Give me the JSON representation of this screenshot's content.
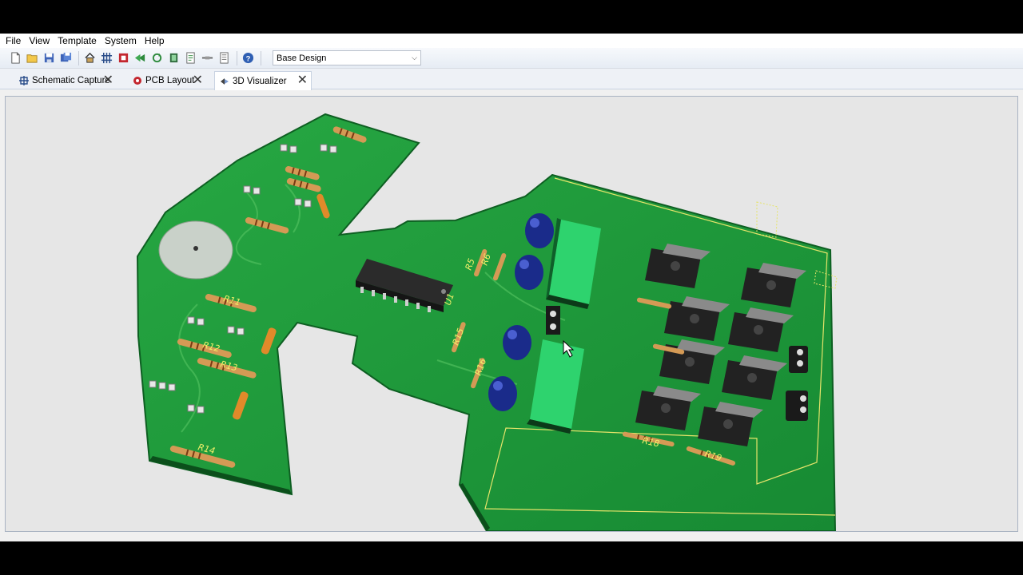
{
  "menu": {
    "items": [
      {
        "label": "File"
      },
      {
        "label": "View"
      },
      {
        "label": "Template"
      },
      {
        "label": "System"
      },
      {
        "label": "Help"
      }
    ]
  },
  "toolbar": {
    "icons": [
      "new-file-icon",
      "open-folder-icon",
      "save-icon",
      "save-all-icon",
      "home-icon",
      "grid-icon",
      "stop-icon",
      "back-icon",
      "refresh-icon",
      "package-icon",
      "document-icon",
      "wire-icon",
      "report-icon",
      "help-icon"
    ],
    "design_variant": "Base Design"
  },
  "tabs": [
    {
      "label": "Schematic Capture",
      "icon": "schematic-icon"
    },
    {
      "label": "PCB Layout",
      "icon": "pcb-icon"
    },
    {
      "label": "3D Visualizer",
      "icon": "3d-icon",
      "active": true
    }
  ],
  "viewport": {
    "background": "#e6e6e6",
    "board_color": "#1f9a3a",
    "silk_color": "#f3f06a",
    "designators": [
      "R11",
      "R12",
      "R13",
      "R14",
      "R15",
      "R16",
      "R5",
      "R6",
      "U1",
      "R18",
      "R19"
    ]
  }
}
